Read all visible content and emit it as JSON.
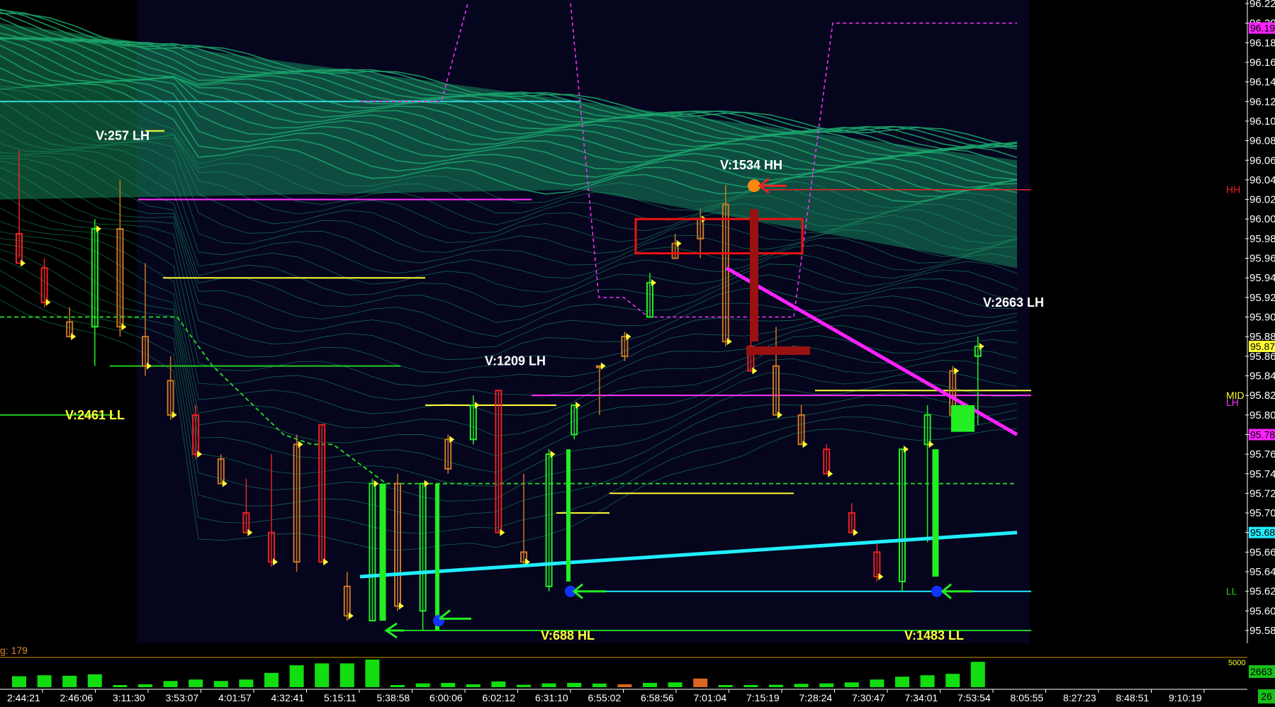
{
  "chart_data": {
    "type": "candlestick",
    "title": "",
    "colors": {
      "background": "#000000",
      "session_background": "#05051e",
      "bull": "#22ee22",
      "bear": "#ee2222",
      "neutral": "#cc7722",
      "mesh": "#1aa36a",
      "trend_down": "#ff22ff",
      "trend_up": "#22eeff",
      "level_yellow": "#ffff33",
      "level_green": "#22cc22",
      "magenta_dash": "#ff33ff",
      "hh_marker": "#ee2222",
      "volume": "#11dd11"
    },
    "y_axis": {
      "min": 95.56,
      "max": 96.22,
      "ticks": [
        "96.22",
        "96.20",
        "96.18",
        "96.16",
        "96.14",
        "96.12",
        "96.10",
        "96.08",
        "96.06",
        "96.04",
        "96.02",
        "96.00",
        "95.98",
        "95.96",
        "95.94",
        "95.92",
        "95.90",
        "95.88",
        "95.86",
        "95.84",
        "95.82",
        "95.80",
        "95.78",
        "95.76",
        "95.74",
        "95.72",
        "95.70",
        "95.68",
        "95.66",
        "95.64",
        "95.62",
        "95.60",
        "95.58"
      ]
    },
    "x_axis": {
      "time_labels": [
        "2:44:21",
        "2:46:06",
        "3:11:30",
        "3:53:07",
        "4:01:57",
        "4:32:41",
        "5:15:11",
        "5:38:58",
        "6:00:06",
        "6:02:12",
        "6:31:10",
        "6:55:02",
        "6:58:56",
        "7:01:04",
        "7:15:19",
        "7:28:24",
        "7:30:47",
        "7:34:01",
        "7:53:54",
        "8:05:55",
        "8:27:23",
        "8:48:51",
        "9:10:19"
      ]
    },
    "price_tags": [
      {
        "text": "96.19",
        "value": 96.195,
        "bg": "#ff22ff",
        "fg": "#000000"
      },
      {
        "text": "95.87",
        "value": 95.87,
        "bg": "#ffff33",
        "fg": "#000000"
      },
      {
        "text": "95.78",
        "value": 95.78,
        "bg": "#ff22ff",
        "fg": "#000000"
      },
      {
        "text": "95.68",
        "value": 95.68,
        "bg": "#22eeff",
        "fg": "#000000"
      }
    ],
    "side_labels": [
      {
        "text": "HH",
        "value": 96.03,
        "color": "#ee2222"
      },
      {
        "text": "MID",
        "value": 95.82,
        "color": "#ffff33"
      },
      {
        "text": "LH",
        "value": 95.82,
        "color": "#ff33ff"
      },
      {
        "text": "LL",
        "value": 95.62,
        "color": "#22cc22"
      }
    ],
    "swing_labels": [
      {
        "text": "V:257 LH",
        "style": "white"
      },
      {
        "text": "V:1534 HH",
        "style": "white"
      },
      {
        "text": "V:2663 LH",
        "style": "white"
      },
      {
        "text": "V:1209 LH",
        "style": "white"
      },
      {
        "text": "V:2461 LL",
        "style": "yellow"
      },
      {
        "text": "V:688 HL",
        "style": "yellow"
      },
      {
        "text": "V:1483 LL",
        "style": "yellow"
      }
    ],
    "candles": [
      {
        "o": 95.985,
        "h": 96.07,
        "l": 95.96,
        "c": 95.955,
        "d": "bear"
      },
      {
        "o": 95.95,
        "h": 95.96,
        "l": 95.91,
        "c": 95.915,
        "d": "bear"
      },
      {
        "o": 95.895,
        "h": 95.91,
        "l": 95.88,
        "c": 95.88,
        "d": "neutral"
      },
      {
        "o": 95.89,
        "h": 96.0,
        "l": 95.85,
        "c": 95.99,
        "d": "bull"
      },
      {
        "o": 95.99,
        "h": 96.04,
        "l": 95.88,
        "c": 95.89,
        "d": "neutral"
      },
      {
        "o": 95.88,
        "h": 95.955,
        "l": 95.84,
        "c": 95.85,
        "d": "neutral"
      },
      {
        "o": 95.835,
        "h": 95.86,
        "l": 95.795,
        "c": 95.8,
        "d": "neutral"
      },
      {
        "o": 95.8,
        "h": 95.81,
        "l": 95.755,
        "c": 95.76,
        "d": "bear"
      },
      {
        "o": 95.755,
        "h": 95.76,
        "l": 95.73,
        "c": 95.73,
        "d": "neutral"
      },
      {
        "o": 95.7,
        "h": 95.735,
        "l": 95.68,
        "c": 95.68,
        "d": "bear"
      },
      {
        "o": 95.68,
        "h": 95.76,
        "l": 95.645,
        "c": 95.65,
        "d": "bear"
      },
      {
        "o": 95.65,
        "h": 95.78,
        "l": 95.64,
        "c": 95.77,
        "d": "neutral"
      },
      {
        "o": 95.79,
        "h": 95.79,
        "l": 95.65,
        "c": 95.65,
        "d": "bear"
      },
      {
        "o": 95.625,
        "h": 95.64,
        "l": 95.59,
        "c": 95.595,
        "d": "neutral"
      },
      {
        "o": 95.59,
        "h": 95.735,
        "l": 95.59,
        "c": 95.73,
        "d": "bull"
      },
      {
        "o": 95.73,
        "h": 95.74,
        "l": 95.6,
        "c": 95.605,
        "d": "neutral"
      },
      {
        "o": 95.6,
        "h": 95.73,
        "l": 95.58,
        "c": 95.73,
        "d": "bull"
      },
      {
        "o": 95.745,
        "h": 95.78,
        "l": 95.74,
        "c": 95.775,
        "d": "neutral"
      },
      {
        "o": 95.775,
        "h": 95.82,
        "l": 95.77,
        "c": 95.81,
        "d": "bull"
      },
      {
        "o": 95.825,
        "h": 95.825,
        "l": 95.68,
        "c": 95.68,
        "d": "bear"
      },
      {
        "o": 95.66,
        "h": 95.74,
        "l": 95.645,
        "c": 95.65,
        "d": "neutral"
      },
      {
        "o": 95.625,
        "h": 95.765,
        "l": 95.62,
        "c": 95.76,
        "d": "bull"
      },
      {
        "o": 95.78,
        "h": 95.81,
        "l": 95.775,
        "c": 95.81,
        "d": "bull"
      },
      {
        "o": 95.85,
        "h": 95.85,
        "l": 95.8,
        "c": 95.85,
        "d": "neutral"
      },
      {
        "o": 95.86,
        "h": 95.885,
        "l": 95.855,
        "c": 95.88,
        "d": "neutral"
      },
      {
        "o": 95.9,
        "h": 95.945,
        "l": 95.9,
        "c": 95.935,
        "d": "bull"
      },
      {
        "o": 95.96,
        "h": 95.985,
        "l": 95.96,
        "c": 95.975,
        "d": "neutral"
      },
      {
        "o": 95.98,
        "h": 96.01,
        "l": 95.96,
        "c": 96.0,
        "d": "neutral"
      },
      {
        "o": 96.015,
        "h": 96.035,
        "l": 95.87,
        "c": 95.875,
        "d": "neutral"
      },
      {
        "o": 95.87,
        "h": 95.885,
        "l": 95.845,
        "c": 95.845,
        "d": "bear"
      },
      {
        "o": 95.85,
        "h": 95.89,
        "l": 95.8,
        "c": 95.8,
        "d": "neutral"
      },
      {
        "o": 95.8,
        "h": 95.81,
        "l": 95.77,
        "c": 95.77,
        "d": "neutral"
      },
      {
        "o": 95.765,
        "h": 95.77,
        "l": 95.74,
        "c": 95.74,
        "d": "bear"
      },
      {
        "o": 95.7,
        "h": 95.71,
        "l": 95.68,
        "c": 95.68,
        "d": "bear"
      },
      {
        "o": 95.66,
        "h": 95.67,
        "l": 95.63,
        "c": 95.635,
        "d": "bear"
      },
      {
        "o": 95.63,
        "h": 95.765,
        "l": 95.62,
        "c": 95.765,
        "d": "bull"
      },
      {
        "o": 95.8,
        "h": 95.81,
        "l": 95.67,
        "c": 95.77,
        "d": "bull"
      },
      {
        "o": 95.8,
        "h": 95.85,
        "l": 95.79,
        "c": 95.845,
        "d": "neutral"
      },
      {
        "o": 95.86,
        "h": 95.88,
        "l": 95.79,
        "c": 95.87,
        "d": "bull"
      }
    ],
    "volume": {
      "scale_label": "5000",
      "current": "2663",
      "left_label": "g: 179",
      "values": [
        1150,
        1250,
        1200,
        1350,
        200,
        300,
        650,
        800,
        650,
        800,
        1500,
        2300,
        2500,
        2500,
        2903,
        150,
        400,
        450,
        300,
        600,
        250,
        400,
        450,
        380,
        300,
        450,
        500,
        900,
        100,
        200,
        250,
        350,
        400,
        500,
        800,
        1100,
        1250,
        1400,
        2663
      ]
    },
    "legend": "none",
    "grid": false
  },
  "corner_tag": "26"
}
